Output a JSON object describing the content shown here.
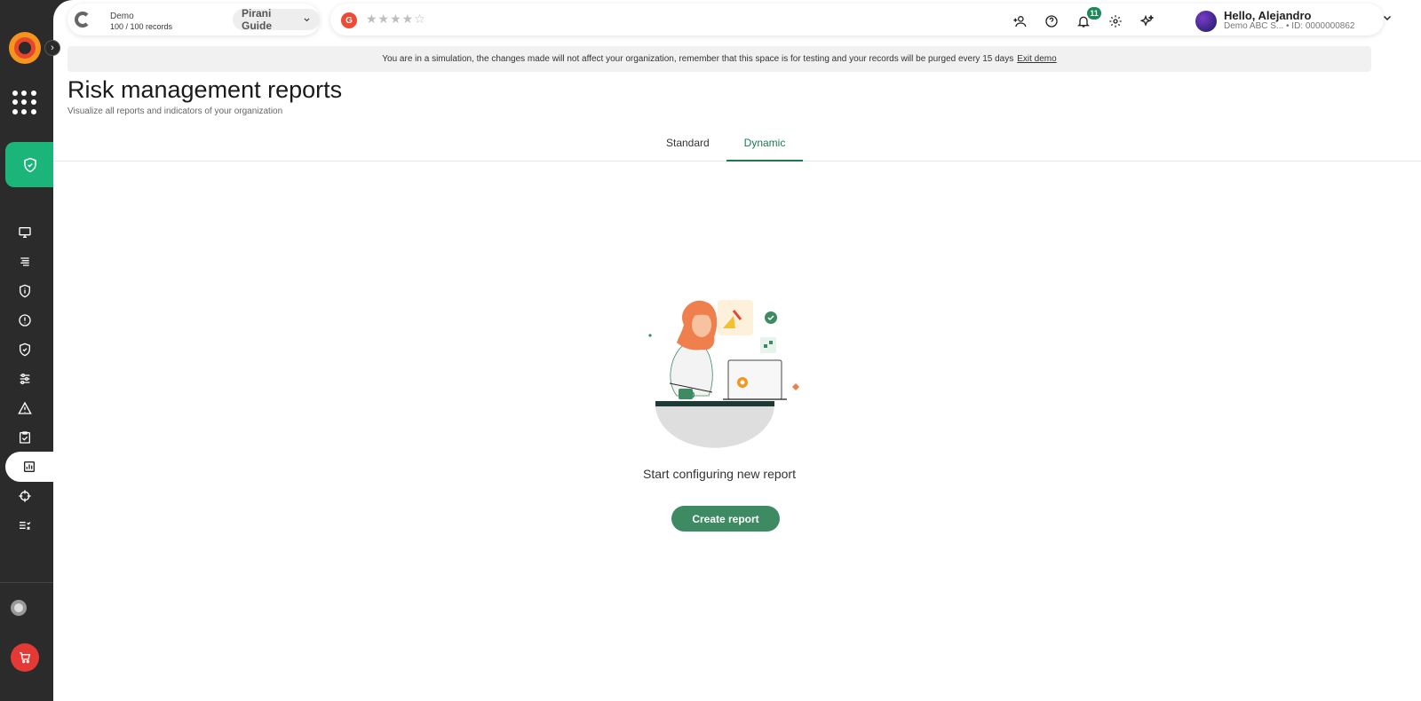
{
  "topbar": {
    "demo_title": "Demo",
    "demo_records": "100 / 100 records",
    "guide_label": "Pirani Guide",
    "g2_letter": "G",
    "rating_stars": "★★★★☆",
    "notification_count": "11",
    "user_greeting": "Hello, Alejandro",
    "user_org": "Demo ABC S... • ID: 0000000862"
  },
  "banner": {
    "message": "You are in a simulation, the changes made will not affect your organization, remember that this space is for testing and your records will be purged every 15 days",
    "exit_label": "Exit demo"
  },
  "page": {
    "title": "Risk management reports",
    "subtitle": "Visualize all reports and indicators of your organization"
  },
  "tabs": [
    {
      "label": "Standard",
      "active": false
    },
    {
      "label": "Dynamic",
      "active": true
    }
  ],
  "empty_state": {
    "message": "Start configuring new report",
    "button_label": "Create report"
  },
  "colors": {
    "accent": "#1bb57a",
    "button": "#3e8a62",
    "sidebar": "#2b2b2b"
  }
}
